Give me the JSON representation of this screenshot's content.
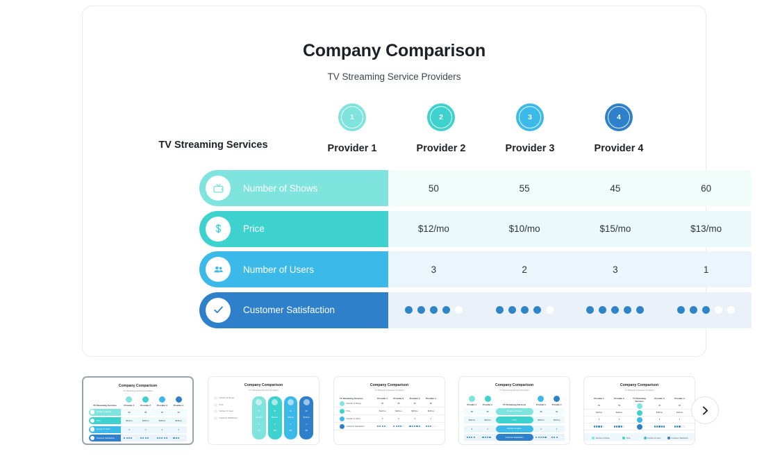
{
  "slide": {
    "title": "Company Comparison",
    "subtitle": "TV Streaming Service Providers",
    "row_header_label": "TV Streaming Services",
    "providers": [
      {
        "number": "1",
        "name": "Provider 1",
        "color": "#7fe3de"
      },
      {
        "number": "2",
        "name": "Provider 2",
        "color": "#3ed2ce"
      },
      {
        "number": "3",
        "name": "Provider 3",
        "color": "#3bb9e8"
      },
      {
        "number": "4",
        "name": "Provider 4",
        "color": "#2e80ca"
      }
    ],
    "rows": [
      {
        "label": "Number of Shows",
        "icon": "tv-icon",
        "pill_color": "#7fe3de",
        "band_color": "#f2fcfb",
        "type": "text",
        "values": [
          "50",
          "55",
          "45",
          "60"
        ]
      },
      {
        "label": "Price",
        "icon": "dollar-icon",
        "pill_color": "#3ed2ce",
        "band_color": "#ebf9fa",
        "type": "text",
        "values": [
          "$12/mo",
          "$10/mo",
          "$15/mo",
          "$13/mo"
        ]
      },
      {
        "label": "Number of Users",
        "icon": "users-icon",
        "pill_color": "#3bb9e8",
        "band_color": "#eaf6fc",
        "type": "text",
        "values": [
          "3",
          "2",
          "3",
          "1"
        ]
      },
      {
        "label": "Customer Satisfaction",
        "icon": "check-icon",
        "pill_color": "#2e80ca",
        "band_color": "#eaf1f8",
        "type": "rating",
        "rating_max": 5,
        "values": [
          4,
          4,
          5,
          3
        ]
      }
    ],
    "dot_colors": {
      "filled": "#2e86c8",
      "empty": "#ffffff"
    }
  },
  "carousel": {
    "next_label": "›",
    "thumbnails": [
      {
        "name": "layout-rows-left-labels",
        "selected": true,
        "layout": "A"
      },
      {
        "name": "layout-vertical-cards",
        "selected": false,
        "layout": "B"
      },
      {
        "name": "layout-plain-table",
        "selected": false,
        "layout": "C"
      },
      {
        "name": "layout-center-labels",
        "selected": false,
        "layout": "D"
      },
      {
        "name": "layout-column-providers",
        "selected": false,
        "layout": "E"
      }
    ],
    "thumb_title": "Company Comparison",
    "thumb_subtitle": "TV Streaming Service Providers"
  }
}
